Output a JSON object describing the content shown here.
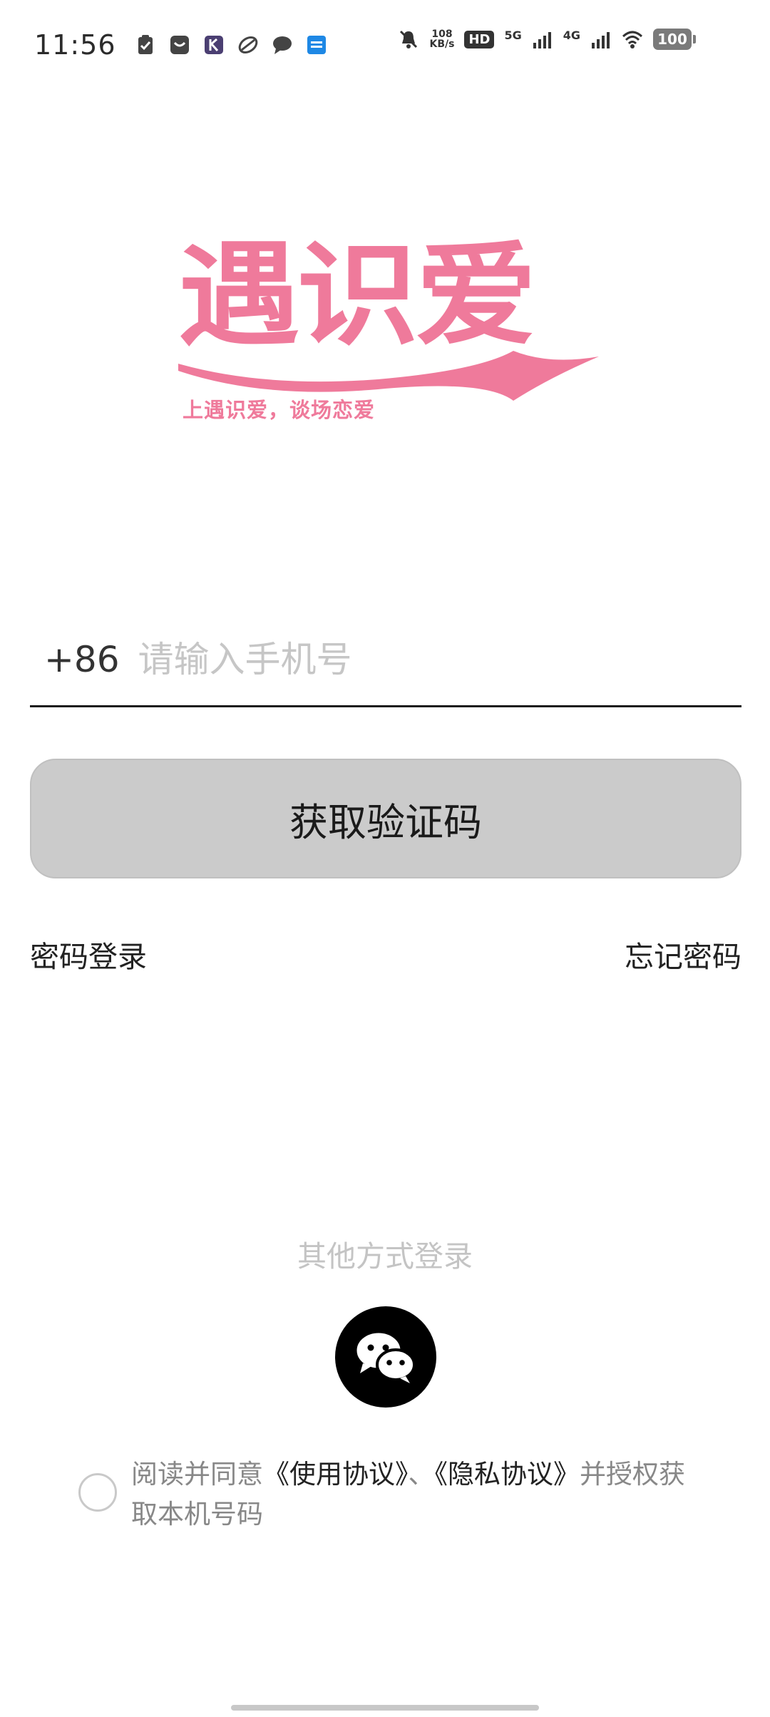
{
  "status_bar": {
    "time": "11:56",
    "net_speed_value": "108",
    "net_speed_unit": "KB/s",
    "hd": "HD",
    "sig1": "5G",
    "sig2": "4G",
    "battery": "100"
  },
  "logo": {
    "title": "遇识爱",
    "slogan": "上遇识爱，谈场恋爱",
    "color": "#ef7a9b"
  },
  "login": {
    "country_code": "+86",
    "phone_placeholder": "请输入手机号",
    "code_button": "获取验证码",
    "password_login": "密码登录",
    "forgot_password": "忘记密码"
  },
  "other": {
    "title": "其他方式登录",
    "wechat_icon": "wechat-icon"
  },
  "agreement": {
    "prefix": "阅读并同意",
    "terms": "《使用协议》",
    "sep": "、",
    "privacy": "《隐私协议》",
    "suffix": "并授权获取本机号码"
  }
}
